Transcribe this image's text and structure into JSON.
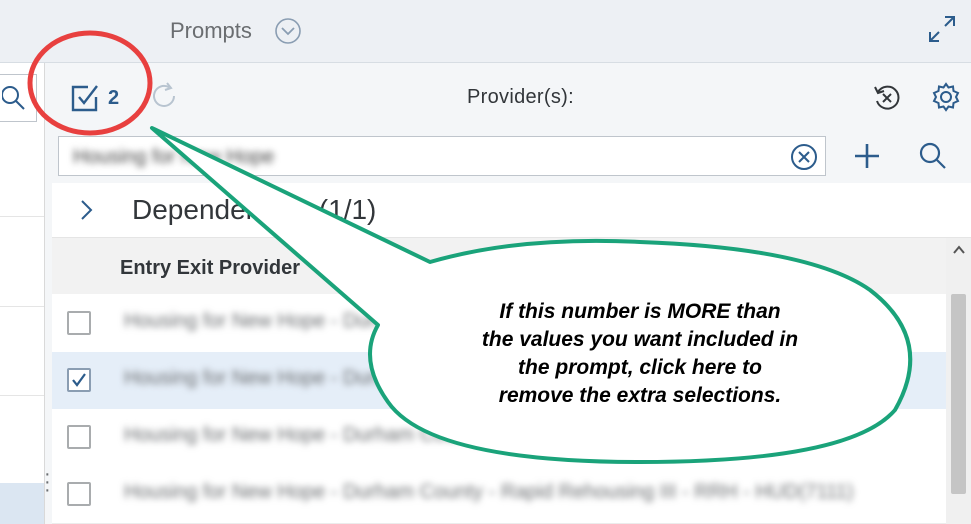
{
  "header": {
    "title": "Prompts",
    "chevron_icon": "circle-chevron-down-icon",
    "expand_icon": "fullscreen-icon"
  },
  "toolbar": {
    "selection_count": "2",
    "provider_label": "Provider(s):",
    "icons": [
      "checkbox-checked-icon",
      "refresh-icon",
      "clear-selection-icon",
      "settings-icon"
    ]
  },
  "search": {
    "value": "Housing for New Hope",
    "icons": [
      "clear-circle-icon",
      "add-icon",
      "search-icon"
    ]
  },
  "group": {
    "label": "Dependencies (1/1)"
  },
  "table": {
    "column_header": "Entry Exit Provider",
    "rows": [
      {
        "text": "Housing for New Hope - Durham County - Rapid Rehousing - HUD(7123)",
        "checked": false
      },
      {
        "text": "Housing for New Hope - Durham County - Rapid Rehousing - HUD(7118)",
        "checked": true
      },
      {
        "text": "Housing for New Hope - Durham County - Rapid Rehousing II - HUD(7044)",
        "checked": false
      },
      {
        "text": "Housing for New Hope - Durham County - Rapid Rehousing III - RRH - HUD(7111)",
        "checked": false
      }
    ]
  },
  "callout": {
    "line1": "If this number is MORE than",
    "line2": "the values you want included in",
    "line3": "the prompt, click here to",
    "line4": "remove the extra selections."
  },
  "colors": {
    "accent": "#2c5c8c",
    "callout_border": "#1aa37a",
    "highlight_circle": "#e8403f",
    "selected_row": "#e5eef8"
  }
}
